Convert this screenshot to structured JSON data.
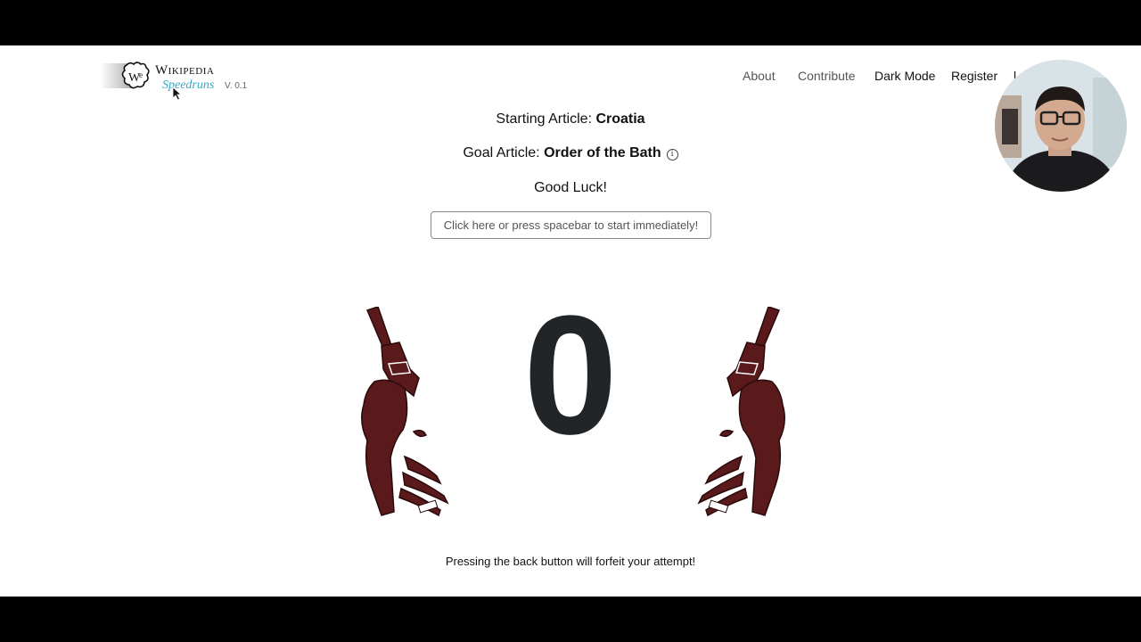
{
  "header": {
    "logo_title": "Wikipedia",
    "logo_subtitle": "Speedruns",
    "version": "V. 0.1",
    "nav": {
      "about": "About",
      "contribute": "Contribute",
      "dark_mode": "Dark Mode",
      "register": "Register",
      "login_partial": "l"
    }
  },
  "game": {
    "starting_label": "Starting Article: ",
    "starting_article": "Croatia",
    "goal_label": "Goal Article: ",
    "goal_article": "Order of the Bath",
    "info_glyph": "i",
    "good_luck": "Good Luck!",
    "start_button": "Click here or press spacebar to start immediately!",
    "countdown": "0",
    "warning": "Pressing the back button will forfeit your attempt!"
  },
  "icons": {
    "logo": "wikipedia-puzzle-globe-icon",
    "info": "info-circle-icon",
    "guns": "revolver-hand-icon",
    "cursor": "mouse-pointer-icon"
  },
  "colors": {
    "accent": "#3aa6c9",
    "countdown": "#222528",
    "gun": "#5a1a1c"
  }
}
